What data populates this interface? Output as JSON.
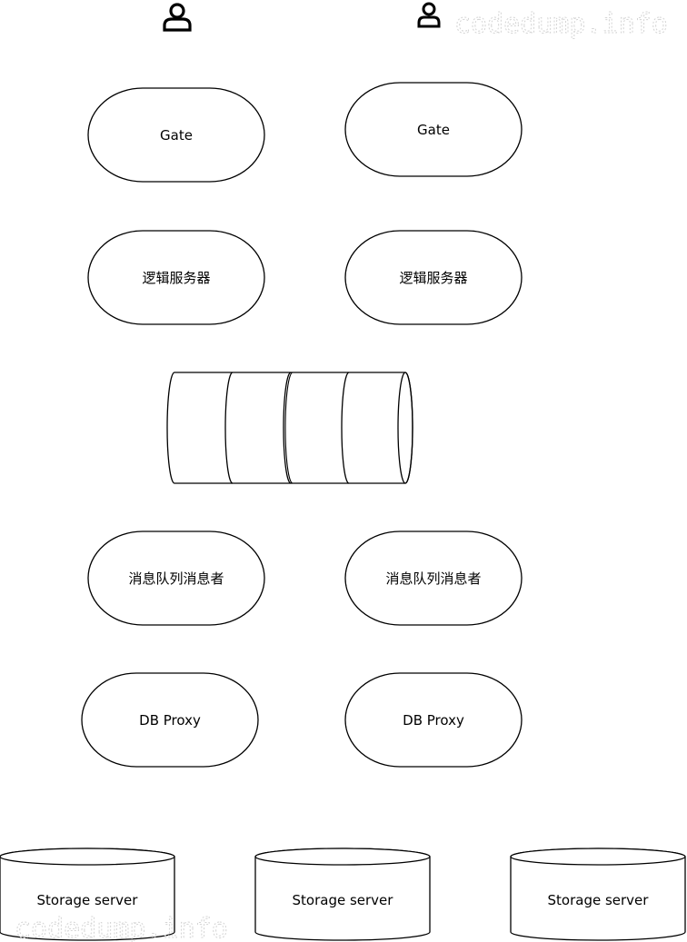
{
  "diagram": {
    "users": [
      {
        "id": "user-1",
        "icon": "user-icon"
      },
      {
        "id": "user-2",
        "icon": "user-icon"
      }
    ],
    "gate_left": {
      "label": "Gate"
    },
    "gate_right": {
      "label": "Gate"
    },
    "logic_left": {
      "label": "逻辑服务器"
    },
    "logic_right": {
      "label": "逻辑服务器"
    },
    "queue": {
      "icon": "message-queue-icon",
      "segments": 4
    },
    "consumer_left": {
      "label": "消息队列消息者"
    },
    "consumer_right": {
      "label": "消息队列消息者"
    },
    "dbproxy_left": {
      "label": "DB Proxy"
    },
    "dbproxy_right": {
      "label": "DB Proxy"
    },
    "storage_1": {
      "label": "Storage server"
    },
    "storage_2": {
      "label": "Storage server"
    },
    "storage_3": {
      "label": "Storage server"
    }
  },
  "watermark": {
    "text": "codedump.info"
  },
  "colors": {
    "stroke": "#000000",
    "fill": "#ffffff",
    "watermark": "#d4d4d4"
  }
}
